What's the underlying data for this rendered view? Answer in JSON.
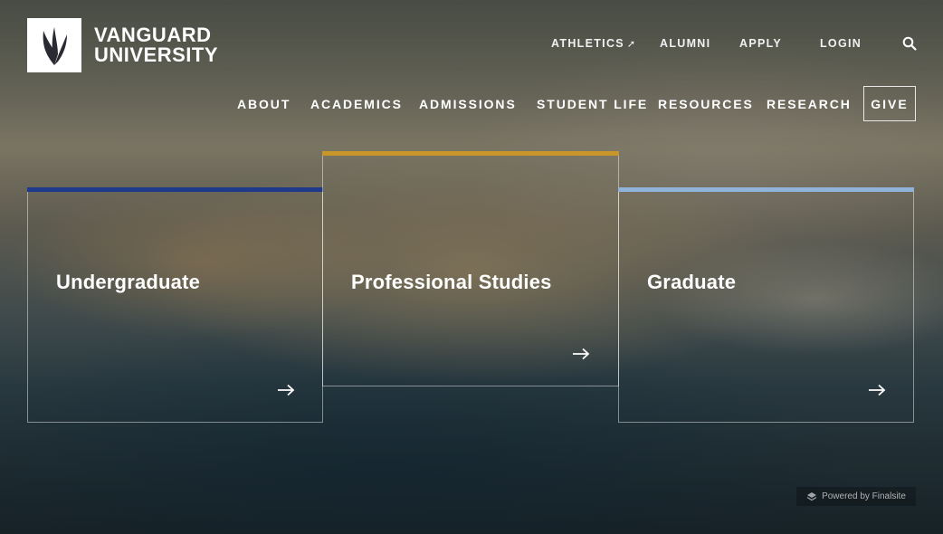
{
  "brand": {
    "line1": "VANGUARD",
    "line2": "UNIVERSITY"
  },
  "utility_nav": [
    {
      "label": "ATHLETICS",
      "icon": "external-arrow-icon"
    },
    {
      "label": "ALUMNI"
    },
    {
      "label": "APPLY"
    },
    {
      "label": "LOGIN"
    }
  ],
  "main_nav": [
    "ABOUT",
    "ACADEMICS",
    "ADMISSIONS",
    "STUDENT LIFE",
    "RESOURCES",
    "RESEARCH"
  ],
  "give_label": "GIVE",
  "cards": [
    {
      "title": "Undergraduate",
      "accent": "#1f3a8a"
    },
    {
      "title": "Professional Studies",
      "accent": "#c9962a"
    },
    {
      "title": "Graduate",
      "accent": "#8fb3d9"
    }
  ],
  "powered_by": "Powered by Finalsite",
  "icons": {
    "search": "search-icon",
    "arrow": "arrow-right-icon",
    "logo": "vanguard-flame-logo-icon",
    "powered": "finalsite-layers-icon"
  }
}
